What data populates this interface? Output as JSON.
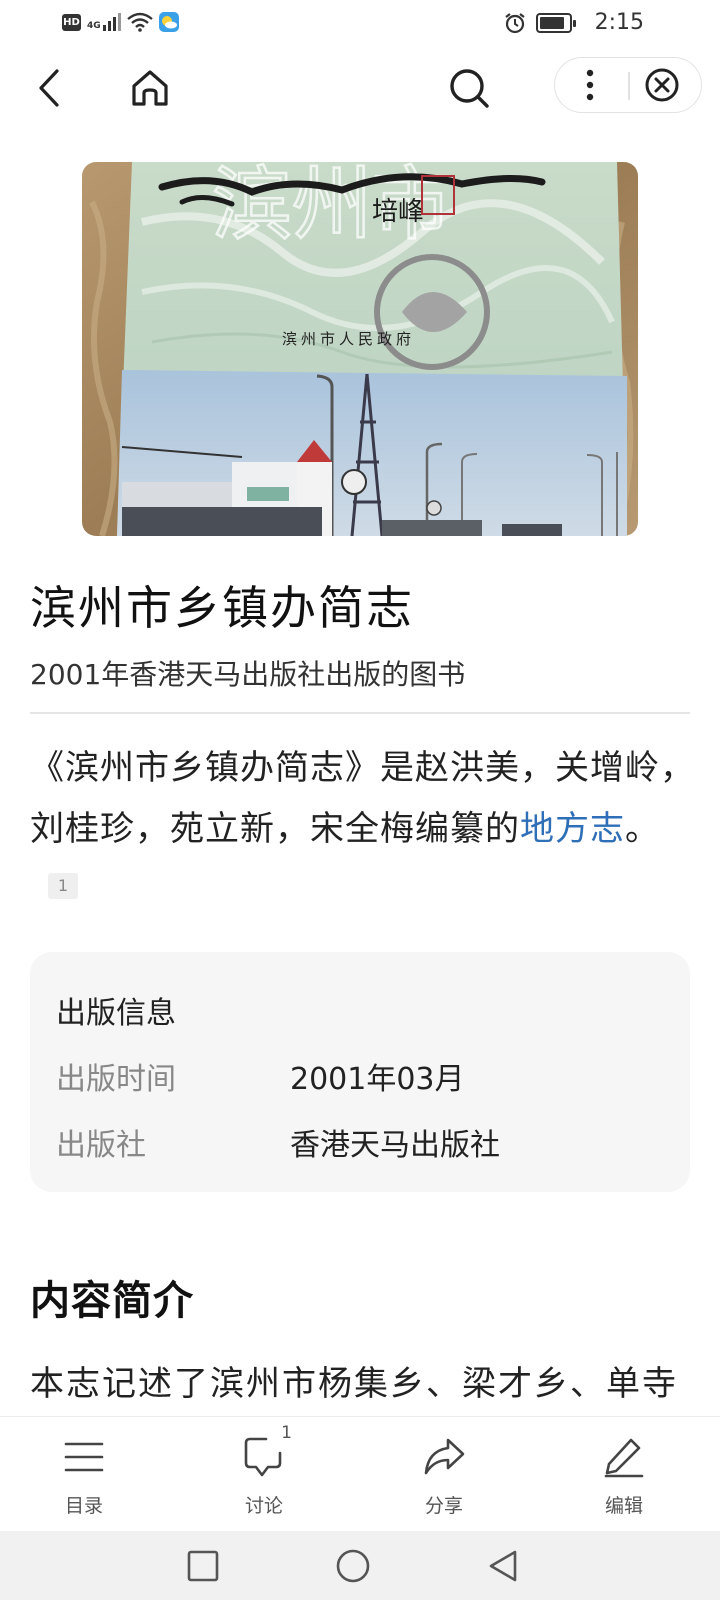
{
  "status_bar": {
    "hd": "HD",
    "network": "4G",
    "time": "2:15",
    "battery_level": 0.85
  },
  "nav": {
    "icons": [
      "back-icon",
      "home-icon",
      "search-icon",
      "more-icon",
      "close-icon"
    ]
  },
  "cover": {
    "publisher_text": "滨州市人民政府"
  },
  "article": {
    "title": "滨州市乡镇办简志",
    "subtitle": "2001年香港天马出版社出版的图书",
    "summary_pre": "《滨州市乡镇办简志》是赵洪美，关增岭，刘桂珍，苑立新，宋全梅编纂的",
    "summary_link": "地方志",
    "summary_post": "。",
    "ref_number": "1"
  },
  "info_card": {
    "title": "出版信息",
    "rows": [
      {
        "label": "出版时间",
        "value": "2001年03月"
      },
      {
        "label": "出版社",
        "value": "香港天马出版社"
      }
    ]
  },
  "content": {
    "heading": "内容简介",
    "text": "本志记述了滨州市杨集乡、梁才乡、单寺"
  },
  "toolbar": {
    "items": [
      {
        "label": "目录",
        "icon": "list-icon"
      },
      {
        "label": "讨论",
        "icon": "comment-icon",
        "count": "1"
      },
      {
        "label": "分享",
        "icon": "share-icon"
      },
      {
        "label": "编辑",
        "icon": "edit-icon"
      }
    ]
  },
  "colors": {
    "link": "#2e6fb7",
    "card_bg": "#f6f6f6",
    "muted_label": "#888888"
  }
}
